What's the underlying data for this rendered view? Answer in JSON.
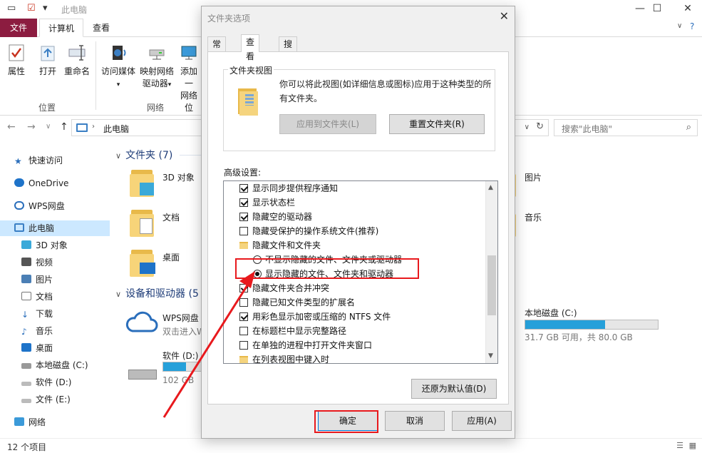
{
  "explorer": {
    "window_title": "此电脑",
    "ribbon_tabs": {
      "file": "文件",
      "computer": "计算机",
      "view": "查看"
    },
    "ribbon": {
      "properties": "属性",
      "open": "打开",
      "rename": "重命名",
      "group_location": "位置",
      "access_media": "访问媒体",
      "map_drive_1": "映射网络",
      "map_drive_2": "驱动器",
      "add_1": "添加一",
      "add_2": "网络位",
      "group_network": "网络"
    },
    "address": "此电脑",
    "search_placeholder": "搜索\"此电脑\"",
    "nav": {
      "quick_access": "快速访问",
      "onedrive": "OneDrive",
      "wps_cloud": "WPS网盘",
      "this_pc": "此电脑",
      "objects3d": "3D 对象",
      "videos": "视频",
      "pictures": "图片",
      "documents": "文档",
      "downloads": "下载",
      "music": "音乐",
      "desktop": "桌面",
      "disk_c": "本地磁盘 (C:)",
      "disk_d": "软件 (D:)",
      "disk_e": "文件 (E:)",
      "network": "网络"
    },
    "content": {
      "folders_header": "文件夹 (7)",
      "devices_header": "设备和驱动器 (5",
      "folders": {
        "f1": "3D 对象",
        "f2": "文档",
        "f3": "桌面",
        "f4": "图片",
        "f5": "音乐"
      },
      "wps": {
        "name": "WPS网盘",
        "sub": "双击进入W"
      },
      "drive_d": {
        "name": "软件 (D:)",
        "free": "102 GB",
        "used_fraction": 0.55
      },
      "drive_c": {
        "name": "本地磁盘 (C:)",
        "free": "31.7 GB 可用，共 80.0 GB",
        "used_fraction": 0.6
      }
    },
    "status": "12 个项目"
  },
  "dialog": {
    "title": "文件夹选项",
    "close": "✕",
    "tabs": {
      "general": "常规",
      "view": "查看",
      "search": "搜索"
    },
    "folder_views": {
      "legend": "文件夹视图",
      "desc": "你可以将此视图(如详细信息或图标)应用于这种类型的所有文件夹。",
      "apply": "应用到文件夹(L)",
      "reset": "重置文件夹(R)"
    },
    "advanced_label": "高级设置:",
    "advanced": {
      "r1": "显示同步提供程序通知",
      "r2": "显示状态栏",
      "r3": "隐藏空的驱动器",
      "r4": "隐藏受保护的操作系统文件(推荐)",
      "r5": "隐藏文件和文件夹",
      "r6": "不显示隐藏的文件、文件夹或驱动器",
      "r7": "显示隐藏的文件、文件夹和驱动器",
      "r8": "隐藏文件夹合并冲突",
      "r9": "隐藏已知文件类型的扩展名",
      "r10": "用彩色显示加密或压缩的 NTFS 文件",
      "r11": "在标题栏中显示完整路径",
      "r12": "在单独的进程中打开文件夹窗口",
      "r13": "在列表视图中键入时"
    },
    "restore": "还原为默认值(D)",
    "ok": "确定",
    "cancel": "取消",
    "apply": "应用(A)"
  },
  "colors": {
    "highlight": "#e8191d",
    "accent": "#26a0da",
    "file_tab": "#8c1c40"
  }
}
